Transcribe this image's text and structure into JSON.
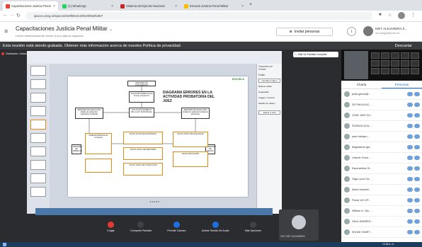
{
  "browser": {
    "tabs": [
      {
        "label": "Capacitaciones Justicia Penal",
        "color": "#e94235"
      },
      {
        "label": "(1) WhatsApp",
        "color": "#25d366"
      },
      {
        "label": "Sistema del Ejercito Nacional",
        "color": "#c62828"
      },
      {
        "label": "Escuela Justicia Penal Militar",
        "color": "#fbbc04"
      }
    ],
    "url": "ipacos.zang.io/spaces/5e9f89c3c29fc29f0a0fc807"
  },
  "app": {
    "title": "Capacitaciones Justicia Penal Militar",
    "subtitle": "Unirse telefónicamente  Unirse a una sala de espacios",
    "invite_label": "Invitar personas",
    "user_name": "KIEY ALEJANDRA Z...",
    "user_email": "csr.xzang@ejercito.mil..."
  },
  "notice": {
    "text": "Esta reunión está siendo grabada. Obtener más información acerca de nuestra Política de privacidad.",
    "download": "Descartar"
  },
  "recording": {
    "label": "Grabación: Iniciada por Carlos Hernán Romero León",
    "fullscreen": "Salir De Pantalla Completa"
  },
  "slide": {
    "title": "DIAGRAMA ERRORES EN LA ACTIVIDAD PROBATORIA DEL JUEZ",
    "root": "ERRORES DE JUZGAMIENTO",
    "nodes": [
      "VIOLACIÓN DIRECTA (Vía Fuerte) (Causal 1ª)",
      "VIOLACIÓN INDIRECTA DE LA LEY SUSTANCIAL",
      "ERRORES DE SELECCIÓN (Fallas de aplicación) (Aplicación indebida)",
      "ERRORES DE SELECCIÓN (Fallas de aplicación) (Falta de aplicación)",
      "ERRORES DE HECHO",
      "ERRORES DE DERECHO",
      "NORMAS BÁSICAS de conceptos",
      "FALSO JUICIO DE EXISTENCIA",
      "FALSO JUICIO DE IDENTIDAD",
      "FALSO RACIOCINIO",
      "FALSO JUICIO DE LEGALIDAD",
      "FALSO JUICIO DE CONVICCIÓN"
    ]
  },
  "format_panel": {
    "heading": "Diapositiva de formato",
    "subheading": "Fondo",
    "change_btn": "Cambiar imagen",
    "options": [
      "Relleno sólido",
      "Degradado",
      "Imagen o textura",
      "Modelo de relleno"
    ],
    "apply_btn": "Aplicar a todo"
  },
  "controls": [
    {
      "label": "Colgar",
      "icon": "hangup-icon"
    },
    {
      "label": "Compartir Pantalla",
      "icon": "share-screen-icon"
    },
    {
      "label": "Permitir Cámara",
      "icon": "camera-icon"
    },
    {
      "label": "Activar Sonido De Audio",
      "icon": "mic-icon"
    },
    {
      "label": "Más Opciones",
      "icon": "more-icon"
    }
  ],
  "self_view_name": "CAP. KIEY ALEJANDRA",
  "sidebar": {
    "tabs": [
      "Charla",
      "Personas"
    ],
    "participants": [
      "juntu.garcia@...",
      "SD PAULA AC...",
      "JOSE JAIR GU...",
      "SORAYA GUIL...",
      "juan hdesym...",
      "Magdalena Igo...",
      "Libardo Grum...",
      "Esperantina Gi...",
      "Olga Lucía Sa...",
      "efram esowell...",
      "Fiscal 141 DP...",
      "William A. Ola...",
      "SAUL ANDRES...",
      "WILMA YANET...",
      "ELSA IDE IPM..."
    ]
  },
  "taskbar": {
    "clock": "10:48 a. m."
  }
}
